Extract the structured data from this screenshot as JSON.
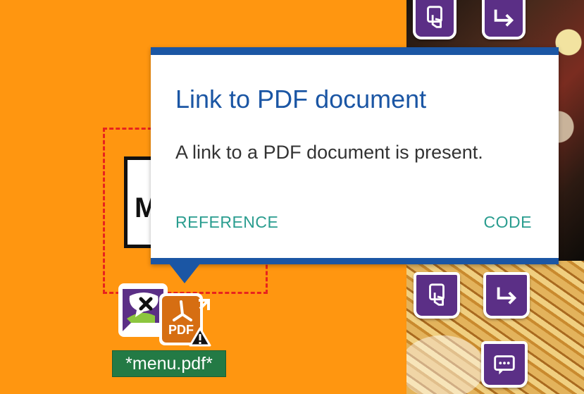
{
  "tooltip": {
    "title": "Link to PDF document",
    "description": "A link to a PDF document is present.",
    "reference_label": "REFERENCE",
    "code_label": "CODE"
  },
  "page": {
    "menu_sign_text": "M",
    "file_label": "*menu.pdf*"
  },
  "pdf_icon": {
    "text": "PDF"
  },
  "icons": {
    "badges": [
      "touch-icon",
      "arrow-right-icon",
      "touch-icon",
      "arrow-right-icon",
      "chat-icon"
    ],
    "comment": "comment-icon",
    "pdf": "pdf-icon",
    "warning": "warning-icon",
    "external": "external-link-icon"
  },
  "colors": {
    "background": "#ff9610",
    "tooltip_accent": "#1b56a4",
    "link": "#2a9d8f",
    "badge": "#5b2f86",
    "error_outline": "#e8231e",
    "file_label_bg": "#237a45",
    "pdf_orange": "#d66e12"
  }
}
